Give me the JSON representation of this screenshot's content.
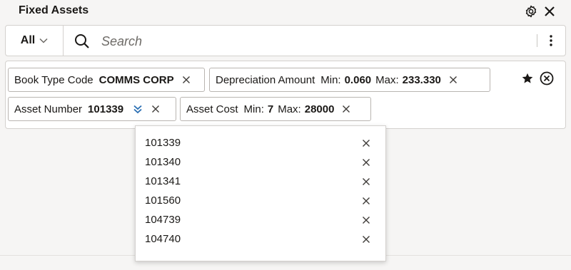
{
  "header": {
    "title": "Fixed Assets",
    "settings_icon": "gear-icon",
    "close_icon": "close-icon"
  },
  "search": {
    "scope_label": "All",
    "placeholder": "Search"
  },
  "filters": {
    "chips": [
      {
        "label": "Book Type Code",
        "value": "COMMS CORP"
      },
      {
        "label": "Depreciation Amount",
        "min_label": "Min:",
        "min": "0.060",
        "max_label": "Max:",
        "max": "233.330"
      },
      {
        "label": "Asset Number",
        "value": "101339"
      },
      {
        "label": "Asset Cost",
        "min_label": "Min:",
        "min": "7",
        "max_label": "Max:",
        "max": "28000"
      }
    ]
  },
  "dropdown": {
    "items": [
      "101339",
      "101340",
      "101341",
      "101560",
      "104739",
      "104740"
    ]
  },
  "colors": {
    "accent": "#2a6fb3",
    "text": "#1a1816",
    "border": "#d4d1ce"
  }
}
